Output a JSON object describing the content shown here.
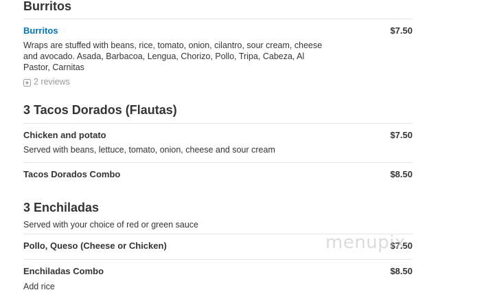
{
  "sections": [
    {
      "title": "Burritos",
      "items": [
        {
          "name": "Burritos",
          "price": "$7.50",
          "description_line1": "Wraps are stuffed with beans, rice, tomato, onion, cilantro, sour cream, cheese",
          "description_line2": "and avocado. Asada, Barbacoa, Lengua, Chorizo, Pollo, Tripa, Cabeza, Al",
          "description_line3": "Pastor, Carnitas",
          "reviews": "2 reviews"
        }
      ]
    },
    {
      "title": "3 Tacos Dorados (Flautas)",
      "items": [
        {
          "name": "Chicken and potato",
          "price": "$7.50",
          "description": "Served with beans, lettuce, tomato, onion, cheese and sour cream"
        },
        {
          "name": "Tacos Dorados Combo",
          "price": "$8.50"
        }
      ]
    },
    {
      "title": "3 Enchiladas",
      "subtitle": "Served with your choice of red or green sauce",
      "items": [
        {
          "name": "Pollo, Queso (Cheese or Chicken)",
          "price": "$7.50"
        },
        {
          "name": "Enchiladas Combo",
          "price": "$8.50",
          "description": "Add rice"
        }
      ]
    }
  ],
  "watermark": "menupix",
  "colors": {
    "link": "#0073bb",
    "text": "#333333",
    "muted": "#999999",
    "divider": "#e6e6e6"
  },
  "icons": {
    "reviews": "review-star-icon"
  }
}
